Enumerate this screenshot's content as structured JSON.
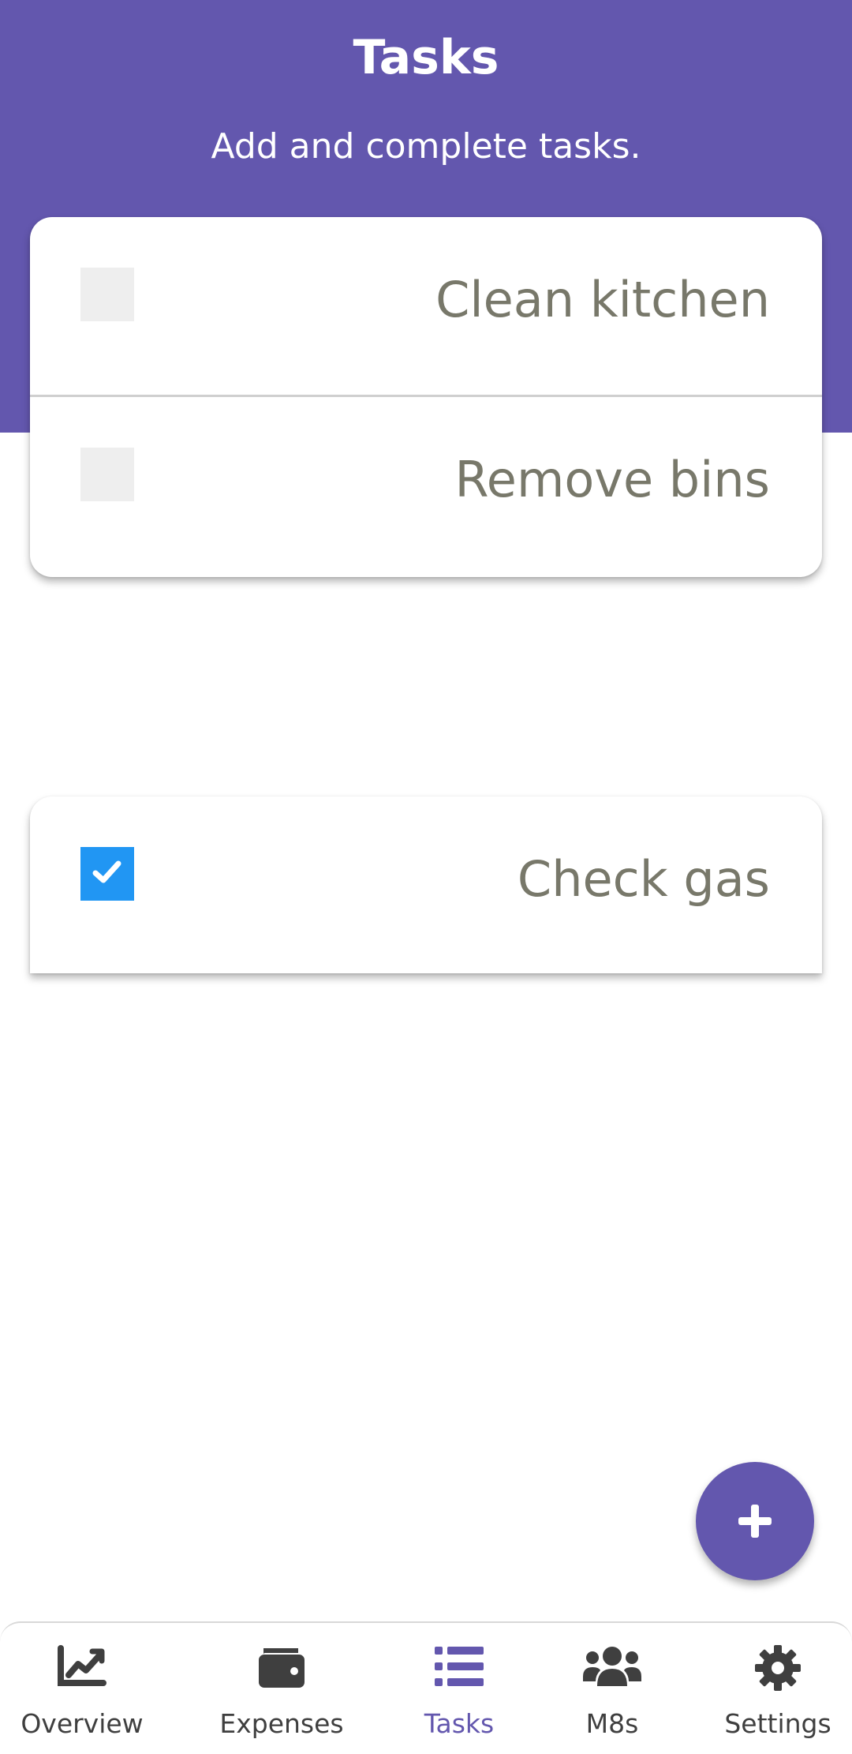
{
  "header": {
    "title": "Tasks",
    "subtitle": "Add and complete tasks."
  },
  "open_tasks": [
    {
      "label": "Clean kitchen",
      "checked": false
    },
    {
      "label": "Remove bins",
      "checked": false
    }
  ],
  "completed_tasks": [
    {
      "label": "Check gas",
      "checked": true
    }
  ],
  "fab": {
    "icon": "plus-icon"
  },
  "bottom_nav": {
    "items": [
      {
        "label": "Overview",
        "icon": "chart-line-icon",
        "active": false
      },
      {
        "label": "Expenses",
        "icon": "wallet-icon",
        "active": false
      },
      {
        "label": "Tasks",
        "icon": "list-icon",
        "active": true
      },
      {
        "label": "M8s",
        "icon": "users-icon",
        "active": false
      },
      {
        "label": "Settings",
        "icon": "gear-icon",
        "active": false
      }
    ]
  },
  "colors": {
    "primary": "#6357ae",
    "checkbox_checked": "#2196f3",
    "task_text": "#78786a",
    "nav_text": "#3f3f3f"
  }
}
